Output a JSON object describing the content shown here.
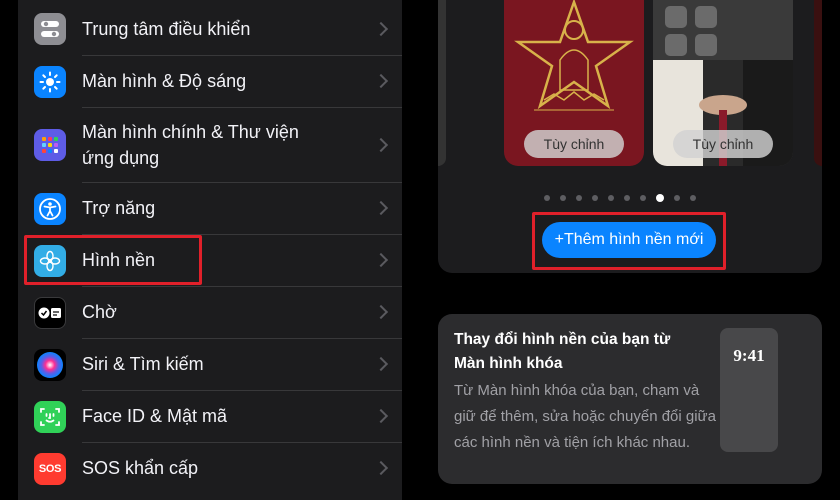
{
  "settings": {
    "items": [
      {
        "label": "Trung tâm điều khiển",
        "icon": "control-center-icon",
        "color": "#8e8e93"
      },
      {
        "label": "Màn hình & Độ sáng",
        "icon": "brightness-icon",
        "color": "#0a84ff"
      },
      {
        "label": "Màn hình chính & Thư viện ứng dụng",
        "label_line1": "Màn hình chính & Thư viện",
        "label_line2": "ứng dụng",
        "icon": "home-screen-icon",
        "color": "#5e5ce6"
      },
      {
        "label": "Trợ năng",
        "icon": "accessibility-icon",
        "color": "#0a84ff"
      },
      {
        "label": "Hình nền",
        "icon": "wallpaper-icon",
        "color": "#32ade6"
      },
      {
        "label": "Chờ",
        "icon": "standby-icon",
        "color": "#000000"
      },
      {
        "label": "Siri & Tìm kiếm",
        "icon": "siri-icon",
        "color": "#1c1c1e"
      },
      {
        "label": "Face ID & Mật mã",
        "icon": "face-id-icon",
        "color": "#30d158"
      },
      {
        "label": "SOS khẩn cấp",
        "icon": "sos-icon",
        "color": "#ff3b30",
        "icon_text": "SOS"
      }
    ]
  },
  "wallpapers": {
    "customize_label_1": "Tùy chỉnh",
    "customize_label_2": "Tùy chỉnh",
    "page_dots": 10,
    "active_dot": 8,
    "add_button_label": "+Thêm hình nền mới"
  },
  "info": {
    "title": "Thay đổi hình nền của bạn từ Màn hình khóa",
    "body": "Từ Màn hình khóa của bạn, chạm và giữ để thêm, sửa hoặc chuyển đổi giữa các hình nền và tiện ích khác nhau.",
    "phone_time": "9:41"
  },
  "colors": {
    "highlight": "#e0202a",
    "accent": "#0a84ff"
  }
}
